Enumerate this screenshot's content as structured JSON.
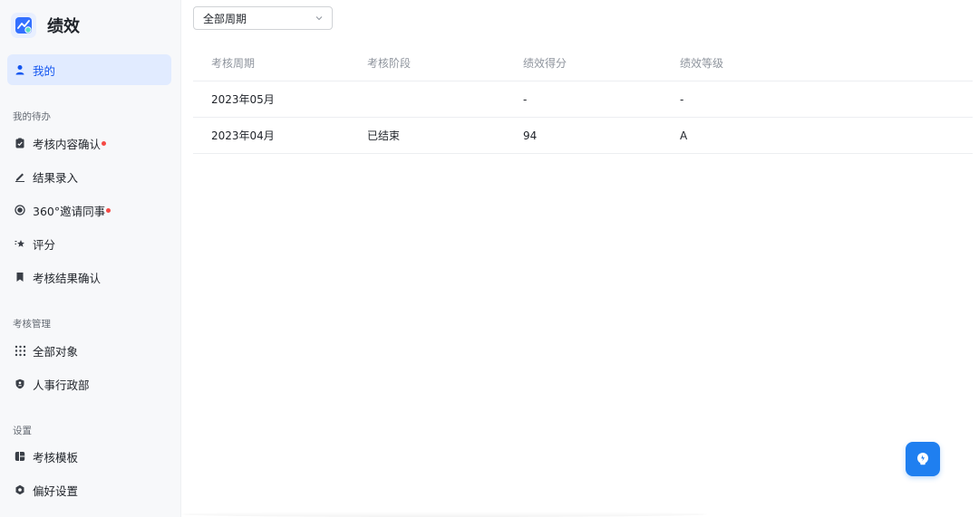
{
  "app": {
    "title": "绩效",
    "logo_icon": "chart-logo-icon",
    "accent": "#1456f0"
  },
  "sidebar": {
    "mine": {
      "label": "我的",
      "icon": "person-icon"
    },
    "sections": [
      {
        "title": "我的待办",
        "items": [
          {
            "label": "考核内容确认",
            "icon": "clipboard-icon",
            "dot": true
          },
          {
            "label": "结果录入",
            "icon": "pen-icon",
            "dot": false
          },
          {
            "label": "360°邀请同事",
            "icon": "target-icon",
            "dot": true
          },
          {
            "label": "评分",
            "icon": "star-icon",
            "dot": false
          },
          {
            "label": "考核结果确认",
            "icon": "bookmark-icon",
            "dot": false
          }
        ]
      },
      {
        "title": "考核管理",
        "items": [
          {
            "label": "全部对象",
            "icon": "grid-icon"
          },
          {
            "label": "人事行政部",
            "icon": "shield-icon"
          }
        ]
      },
      {
        "title": "设置",
        "items": [
          {
            "label": "考核模板",
            "icon": "template-icon"
          },
          {
            "label": "偏好设置",
            "icon": "settings-icon"
          }
        ]
      }
    ]
  },
  "filter": {
    "period_value": "全部周期"
  },
  "table": {
    "headers": [
      "考核周期",
      "考核阶段",
      "绩效得分",
      "绩效等级"
    ],
    "rows": [
      {
        "period": "2023年05月",
        "stage": "",
        "score": "-",
        "grade": "-"
      },
      {
        "period": "2023年04月",
        "stage": "已结束",
        "score": "94",
        "grade": "A"
      }
    ]
  },
  "fab": {
    "icon": "lightbulb-icon",
    "color": "#1f7ff0"
  }
}
